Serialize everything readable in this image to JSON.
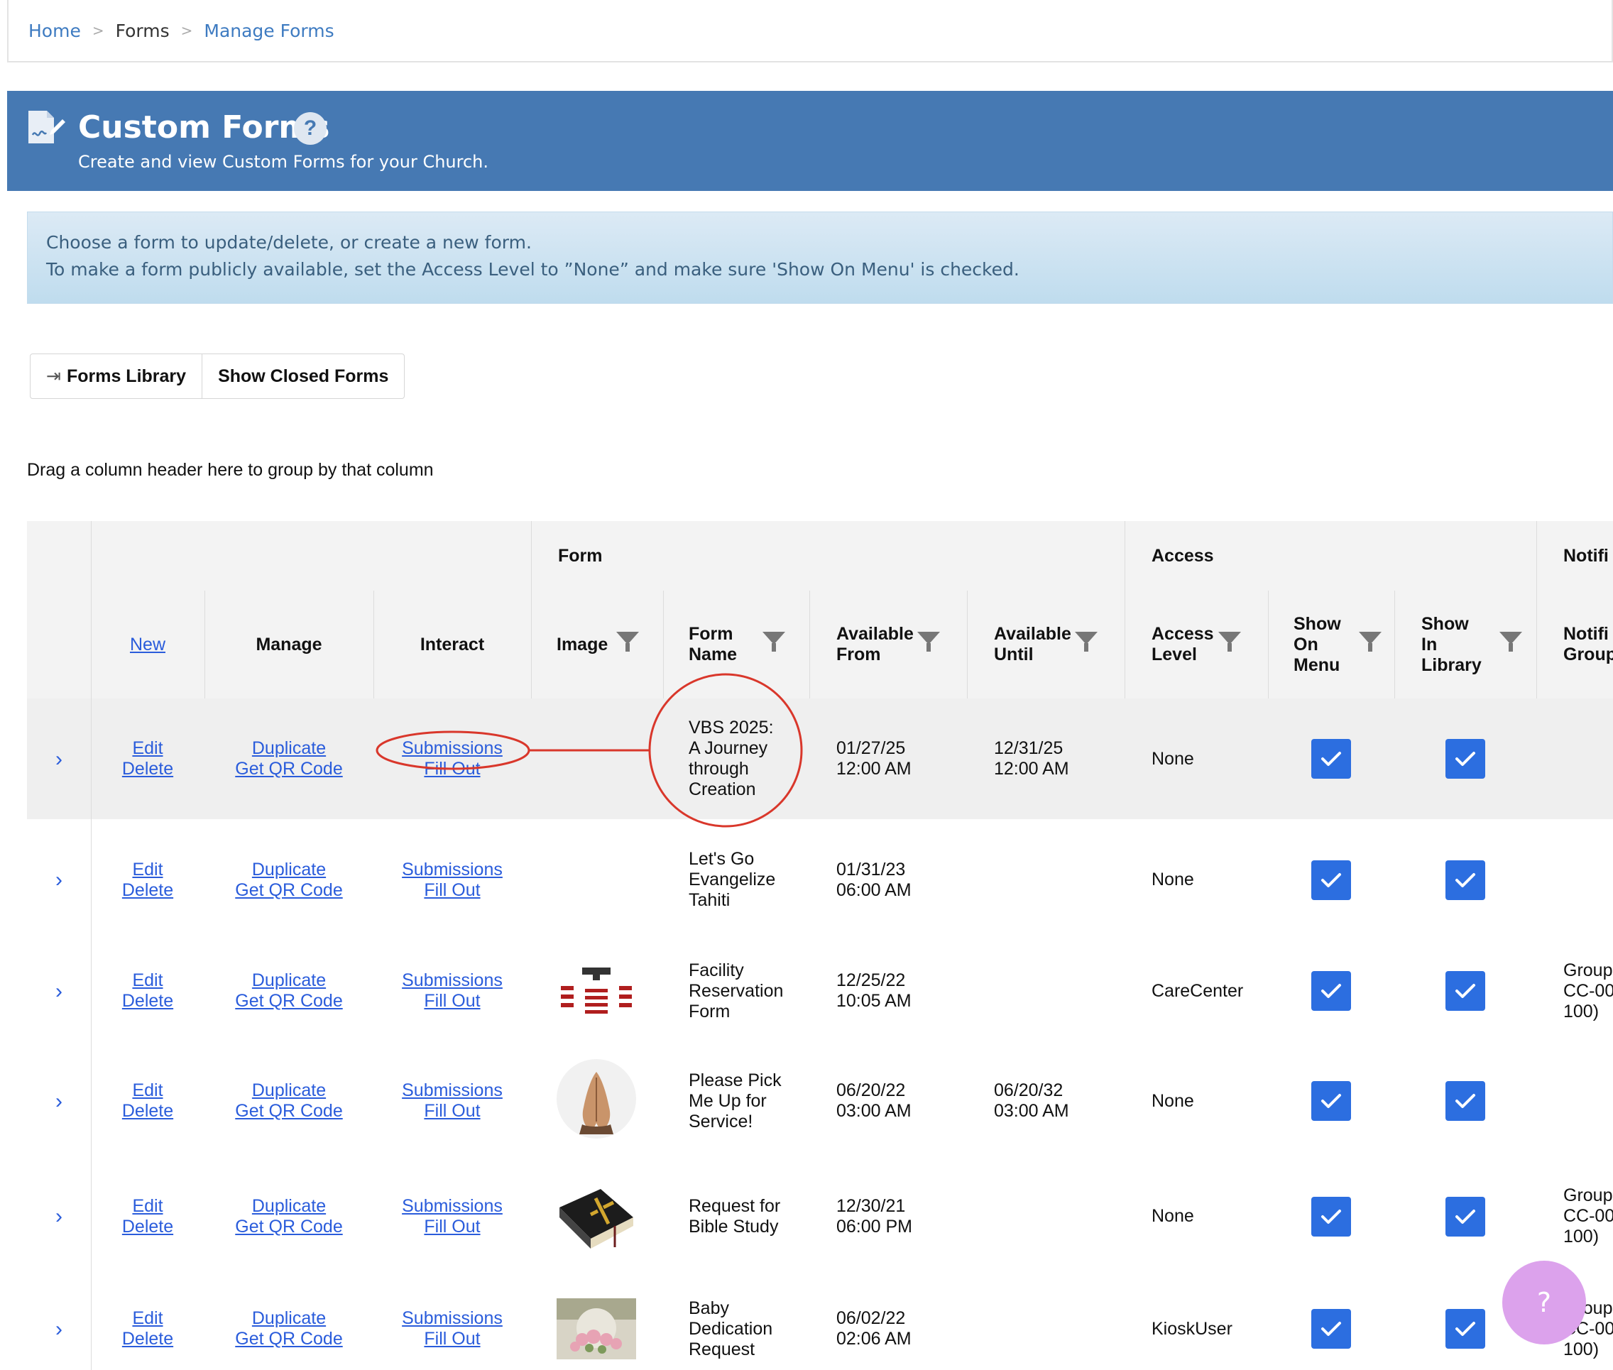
{
  "breadcrumb": {
    "home": "Home",
    "forms": "Forms",
    "manage": "Manage Forms"
  },
  "header": {
    "title": "Custom Forms",
    "help": "?",
    "subtitle": "Create and view Custom Forms for your Church."
  },
  "info": {
    "line1": "Choose a form to update/delete, or create a new form.",
    "line2": "To make a form publicly available, set the Access Level to ”None” and make sure 'Show On Menu' is checked."
  },
  "buttons": {
    "forms_library": "Forms Library",
    "show_closed": "Show Closed Forms"
  },
  "group_hint": "Drag a column header here to group by that column",
  "grid": {
    "groups": {
      "form": "Form",
      "access": "Access",
      "notifications": "Notifi"
    },
    "columns": {
      "new": "New",
      "manage": "Manage",
      "interact": "Interact",
      "image": "Image",
      "form_name": [
        "Form",
        "Name"
      ],
      "available_from": [
        "Available",
        "From"
      ],
      "available_until": [
        "Available",
        "Until"
      ],
      "access_level": [
        "Access",
        "Level"
      ],
      "show_on_menu": [
        "Show",
        "On",
        "Menu"
      ],
      "show_in_library": [
        "Show",
        "In",
        "Library"
      ],
      "notification_group": [
        "Notifi",
        "Group"
      ]
    },
    "row_links": {
      "edit": "Edit",
      "delete": "Delete",
      "duplicate": "Duplicate",
      "qr": "Get QR Code",
      "submissions": "Submissions",
      "fill_out": "Fill Out"
    },
    "rows": [
      {
        "name": [
          "VBS 2025:",
          "A Journey",
          "through",
          "Creation"
        ],
        "from": [
          "01/27/25",
          "12:00 AM"
        ],
        "until": [
          "12/31/25",
          "12:00 AM"
        ],
        "access": "None",
        "show_on_menu": true,
        "show_in_library": true,
        "notification": [],
        "image": "none",
        "highlight": true
      },
      {
        "name": [
          "Let's Go",
          "Evangelize",
          "Tahiti"
        ],
        "from": [
          "01/31/23",
          "06:00 AM"
        ],
        "until": [],
        "access": "None",
        "show_on_menu": true,
        "show_in_library": true,
        "notification": [],
        "image": "none"
      },
      {
        "name": [
          "Facility",
          "Reservation",
          "Form"
        ],
        "from": [
          "12/25/22",
          "10:05 AM"
        ],
        "until": [],
        "access": "CareCenter",
        "show_on_menu": true,
        "show_in_library": true,
        "notification": [
          "Group",
          "CC-00",
          "100)"
        ],
        "image": "seating-chart-image"
      },
      {
        "name": [
          "Please Pick",
          "Me Up for",
          "Service!"
        ],
        "from": [
          "06/20/22",
          "03:00 AM"
        ],
        "until": [
          "06/20/32",
          "03:00 AM"
        ],
        "access": "None",
        "show_on_menu": true,
        "show_in_library": true,
        "notification": [],
        "image": "praying-hands-image"
      },
      {
        "name": [
          "Request for",
          "Bible Study"
        ],
        "from": [
          "12/30/21",
          "06:00 PM"
        ],
        "until": [],
        "access": "None",
        "show_on_menu": true,
        "show_in_library": true,
        "notification": [
          "Group",
          "CC-00",
          "100)"
        ],
        "image": "bible-image"
      },
      {
        "name": [
          "Baby",
          "Dedication",
          "Request"
        ],
        "from": [
          "06/02/22",
          "02:06 AM"
        ],
        "until": [],
        "access": "KioskUser",
        "show_on_menu": true,
        "show_in_library": true,
        "notification": [
          "Group",
          "CC-00",
          "100)"
        ],
        "image": "flowers-image"
      }
    ]
  },
  "help_fab": "?",
  "colors": {
    "banner": "#4679b3",
    "link": "#2a5cdb",
    "checkbox": "#2c6ee0",
    "annotation": "#d9372b",
    "fab": "#dca2ec"
  }
}
